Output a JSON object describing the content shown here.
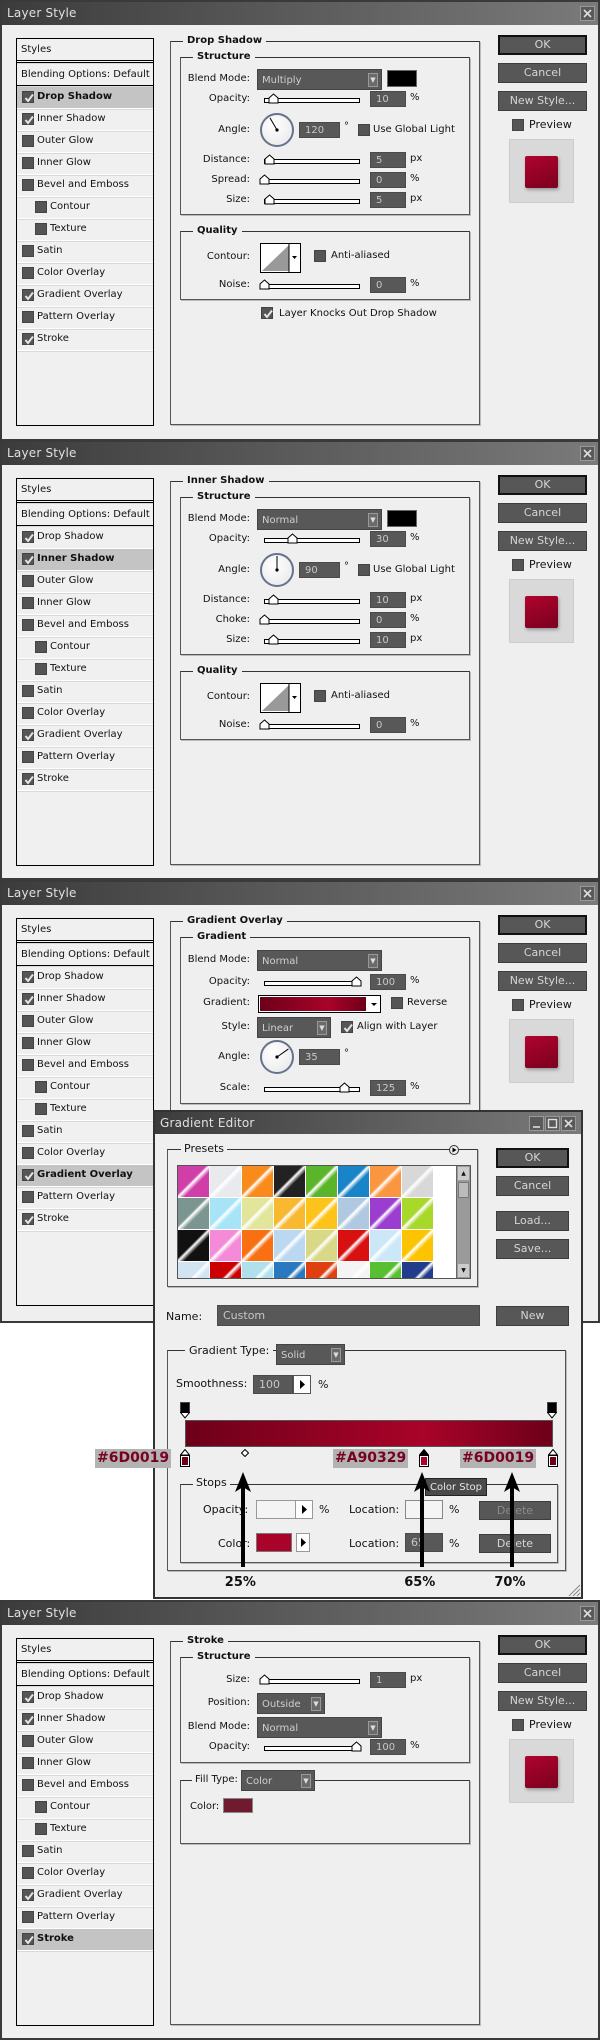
{
  "shared": {
    "window_title": "Layer Style",
    "styles_header": "Styles",
    "blending_options": "Blending Options: Default",
    "style_items": [
      {
        "label": "Drop Shadow",
        "checked": true,
        "indent": false
      },
      {
        "label": "Inner Shadow",
        "checked": true,
        "indent": false
      },
      {
        "label": "Outer Glow",
        "checked": false,
        "indent": false
      },
      {
        "label": "Inner Glow",
        "checked": false,
        "indent": false
      },
      {
        "label": "Bevel and Emboss",
        "checked": false,
        "indent": false
      },
      {
        "label": "Contour",
        "checked": false,
        "indent": true
      },
      {
        "label": "Texture",
        "checked": false,
        "indent": true
      },
      {
        "label": "Satin",
        "checked": false,
        "indent": false
      },
      {
        "label": "Color Overlay",
        "checked": false,
        "indent": false
      },
      {
        "label": "Gradient Overlay",
        "checked": true,
        "indent": false
      },
      {
        "label": "Pattern Overlay",
        "checked": false,
        "indent": false
      },
      {
        "label": "Stroke",
        "checked": true,
        "indent": false
      }
    ],
    "buttons": {
      "ok": "OK",
      "cancel": "Cancel",
      "new_style": "New Style..."
    },
    "preview_label": "Preview",
    "preview_checked": false,
    "preview_color": "#b0042c"
  },
  "dialogs": [
    {
      "selected_style": 0,
      "panel": {
        "title": "Drop Shadow",
        "structure_label": "Structure",
        "quality_label": "Quality",
        "blend_mode": {
          "label": "Blend Mode:",
          "value": "Multiply",
          "color": "#000000"
        },
        "opacity": {
          "label": "Opacity:",
          "value": "10",
          "unit": "%"
        },
        "angle": {
          "label": "Angle:",
          "value": "120",
          "unit": "°",
          "global_light_label": "Use Global Light",
          "global_light": false
        },
        "distance": {
          "label": "Distance:",
          "value": "5",
          "unit": "px"
        },
        "spread": {
          "label": "Spread:",
          "value": "0",
          "unit": "%"
        },
        "size": {
          "label": "Size:",
          "value": "5",
          "unit": "px"
        },
        "contour": {
          "label": "Contour:",
          "anti_aliased_label": "Anti-aliased",
          "anti_aliased": false
        },
        "noise": {
          "label": "Noise:",
          "value": "0",
          "unit": "%"
        },
        "knocks_out": {
          "label": "Layer Knocks Out Drop Shadow",
          "checked": true
        }
      }
    },
    {
      "selected_style": 1,
      "panel": {
        "title": "Inner Shadow",
        "structure_label": "Structure",
        "quality_label": "Quality",
        "blend_mode": {
          "label": "Blend Mode:",
          "value": "Normal",
          "color": "#000000"
        },
        "opacity": {
          "label": "Opacity:",
          "value": "30",
          "unit": "%"
        },
        "angle": {
          "label": "Angle:",
          "value": "90",
          "unit": "°",
          "global_light_label": "Use Global Light",
          "global_light": false
        },
        "distance": {
          "label": "Distance:",
          "value": "10",
          "unit": "px"
        },
        "choke": {
          "label": "Choke:",
          "value": "0",
          "unit": "%"
        },
        "size": {
          "label": "Size:",
          "value": "10",
          "unit": "px"
        },
        "contour": {
          "label": "Contour:",
          "anti_aliased_label": "Anti-aliased",
          "anti_aliased": false
        },
        "noise": {
          "label": "Noise:",
          "value": "0",
          "unit": "%"
        }
      }
    },
    {
      "selected_style": 9,
      "panel": {
        "title": "Gradient Overlay",
        "gradient_label": "Gradient",
        "blend_mode": {
          "label": "Blend Mode:",
          "value": "Normal"
        },
        "opacity": {
          "label": "Opacity:",
          "value": "100",
          "unit": "%"
        },
        "gradient": {
          "label": "Gradient:",
          "reverse_label": "Reverse",
          "reverse": false
        },
        "style": {
          "label": "Style:",
          "value": "Linear",
          "align_label": "Align with Layer",
          "align": true
        },
        "angle": {
          "label": "Angle:",
          "value": "35",
          "unit": "°"
        },
        "scale": {
          "label": "Scale:",
          "value": "125",
          "unit": "%"
        }
      }
    },
    {
      "selected_style": 11,
      "panel": {
        "title": "Stroke",
        "structure_label": "Structure",
        "size": {
          "label": "Size:",
          "value": "1",
          "unit": "px"
        },
        "position": {
          "label": "Position:",
          "value": "Outside"
        },
        "blend_mode": {
          "label": "Blend Mode:",
          "value": "Normal"
        },
        "opacity": {
          "label": "Opacity:",
          "value": "100",
          "unit": "%"
        },
        "fill_type": {
          "label": "Fill Type:",
          "value": "Color"
        },
        "color": {
          "label": "Color:",
          "value": "#6f1a2e"
        }
      }
    }
  ],
  "gradient_editor": {
    "title": "Gradient Editor",
    "presets_label": "Presets",
    "presets": [
      "#d03fa8",
      "#e8eaee",
      "#f98a1c",
      "#222222",
      "#5bb52a",
      "#1a84c8",
      "#fa9640",
      "#d8d8d8",
      "#7b9690",
      "#a7e4f8",
      "#e1e69a",
      "#f8b830",
      "#fcc41a",
      "#b0c8e0",
      "#9b3ed0",
      "#a8d82a",
      "#111111",
      "#f58ad8",
      "#f97012",
      "#bcd8f0",
      "#d8d888",
      "#d81010",
      "#cce8f8",
      "#fcc400",
      "#d0e4f4",
      "#cc0000",
      "#b0e0ec",
      "#2a78c0",
      "#e04010",
      "#f4f4f4",
      "#58c030",
      "#223c8c"
    ],
    "buttons": {
      "ok": "OK",
      "cancel": "Cancel",
      "load": "Load...",
      "save": "Save..."
    },
    "name_label": "Name:",
    "name_value": "Custom",
    "new_label": "New",
    "gradient_type_label": "Gradient Type:",
    "gradient_type": "Solid",
    "smoothness_label": "Smoothness:",
    "smoothness": "100",
    "smoothness_unit": "%",
    "color_stops": [
      {
        "color": "#6D0019",
        "location": 0
      },
      {
        "color": "#A90329",
        "location": 65
      },
      {
        "color": "#6D0019",
        "location": 100
      }
    ],
    "midpoints": [
      25,
      70
    ],
    "stops_label": "Stops",
    "opacity_label": "Opacity:",
    "opacity_unit": "%",
    "location_label": "Location:",
    "location_unit": "%",
    "delete_label": "Delete",
    "color_label": "Color:",
    "color_location": "65",
    "selected_color": "#A90329",
    "tooltip": "Color Stop",
    "annotations": {
      "hex_labels": [
        "#6D0019",
        "#A90329",
        "#6D0019"
      ],
      "percent_labels": [
        "25%",
        "65%",
        "70%"
      ]
    }
  }
}
